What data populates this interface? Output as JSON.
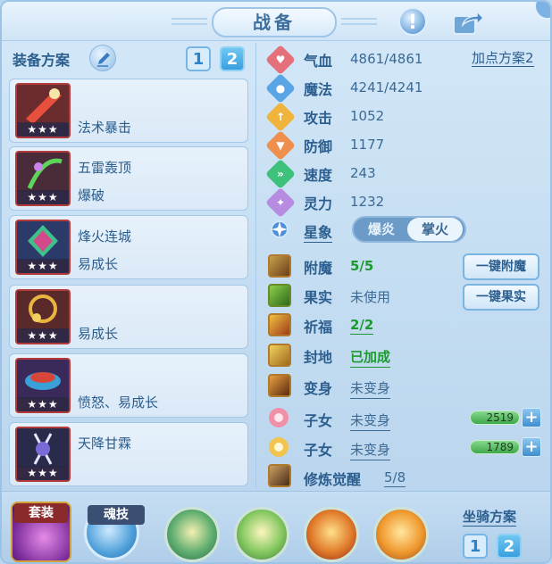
{
  "title": "战备",
  "left": {
    "plan_label": "装备方案",
    "plan_buttons": [
      "1",
      "2"
    ],
    "equipment": [
      {
        "line1": "",
        "line2": "法术暴击",
        "stars": "★★★"
      },
      {
        "line1": "五雷轰顶",
        "line2": "爆破",
        "stars": "★★★"
      },
      {
        "line1": "烽火连城",
        "line2": "易成长",
        "stars": "★★★"
      },
      {
        "line1": "",
        "line2": "易成长",
        "stars": "★★★"
      },
      {
        "line1": "",
        "line2": "愤怒、易成长",
        "stars": "★★★"
      },
      {
        "line1": "天降甘霖",
        "line2": "",
        "stars": "★★★"
      }
    ]
  },
  "stats": {
    "add_plan": "加点方案2",
    "items": [
      {
        "label": "气血",
        "value": "4861/4861",
        "color": "#e3707b",
        "icon": "heart-icon",
        "glyph": "♥"
      },
      {
        "label": "魔法",
        "value": "4241/4241",
        "color": "#5aa5e6",
        "icon": "mana-icon",
        "glyph": "●"
      },
      {
        "label": "攻击",
        "value": "1052",
        "color": "#f0b43c",
        "icon": "attack-icon",
        "glyph": "↑"
      },
      {
        "label": "防御",
        "value": "1177",
        "color": "#ef8f4e",
        "icon": "defense-icon",
        "glyph": "▼"
      },
      {
        "label": "速度",
        "value": "243",
        "color": "#3ec17a",
        "icon": "speed-icon",
        "glyph": "»"
      },
      {
        "label": "灵力",
        "value": "1232",
        "color": "#b68be0",
        "icon": "spirit-icon",
        "glyph": "✦"
      }
    ]
  },
  "constellation": {
    "label": "星象",
    "options": [
      "爆炎",
      "掌火"
    ],
    "selected": "掌火"
  },
  "effects": [
    {
      "label": "附魔",
      "value": "5/5",
      "style": "green"
    },
    {
      "label": "果实",
      "value": "未使用",
      "style": "plain"
    },
    {
      "label": "祈福",
      "value": "2/2",
      "style": "green-underline"
    },
    {
      "label": "封地",
      "value": "已加成",
      "style": "green-underline"
    },
    {
      "label": "变身",
      "value": "未变身",
      "style": "underline"
    }
  ],
  "buttons": {
    "enchant": "一键附魔",
    "fruit": "一键果实"
  },
  "children": [
    {
      "label": "子女",
      "value": "未变身",
      "bar": "2519",
      "color": "#f08fa6"
    },
    {
      "label": "子女",
      "value": "未变身",
      "bar": "1789",
      "color": "#f2c44e"
    }
  ],
  "cultivation": {
    "label": "修炼觉醒",
    "value": "5/8"
  },
  "bottom": {
    "suit_label": "套装",
    "soul_label": "魂技",
    "mount_label": "坐骑方案",
    "mount_buttons": [
      "1",
      "2"
    ]
  }
}
